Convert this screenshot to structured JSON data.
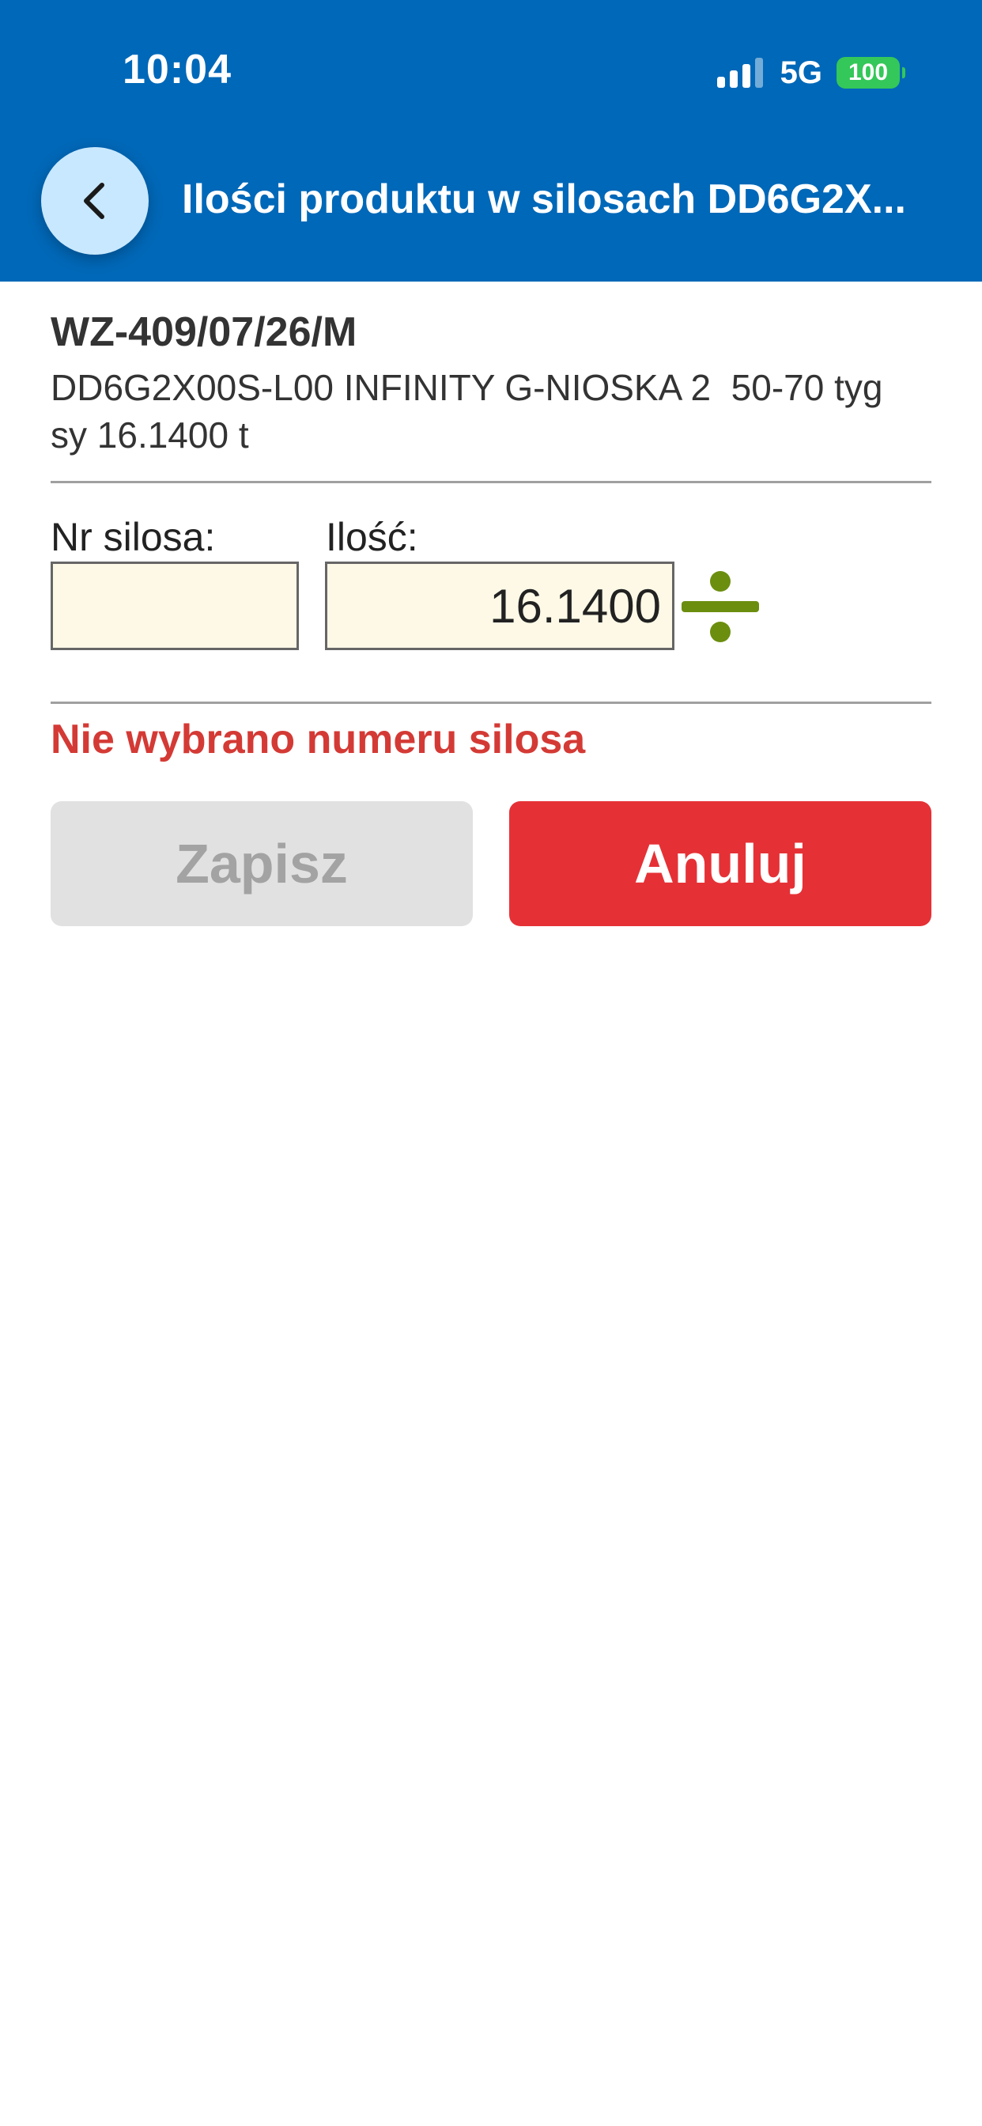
{
  "status_bar": {
    "time": "10:04",
    "network": "5G",
    "battery": "100"
  },
  "header": {
    "title": "Ilości produktu w silosach DD6G2X..."
  },
  "document": {
    "number": "WZ-409/07/26/M",
    "description": "DD6G2X00S-L00 INFINITY G-NIOSKA 2  50-70 tyg  sy 16.1400 t"
  },
  "form": {
    "silo_label": "Nr silosa:",
    "silo_value": "",
    "quantity_label": "Ilość:",
    "quantity_value": "16.1400"
  },
  "error_message": "Nie wybrano numeru silosa",
  "buttons": {
    "save_label": "Zapisz",
    "cancel_label": "Anuluj"
  },
  "colors": {
    "header_bg": "#0068b8",
    "accent_green": "#6b8e0f",
    "error_red": "#d43a35",
    "cancel_red": "#e53136",
    "input_bg": "#fdf9e6",
    "battery_green": "#34c759"
  },
  "icons": {
    "back": "chevron-left-icon",
    "divide": "divide-icon",
    "signal": "signal-bars-icon",
    "battery": "battery-icon"
  }
}
